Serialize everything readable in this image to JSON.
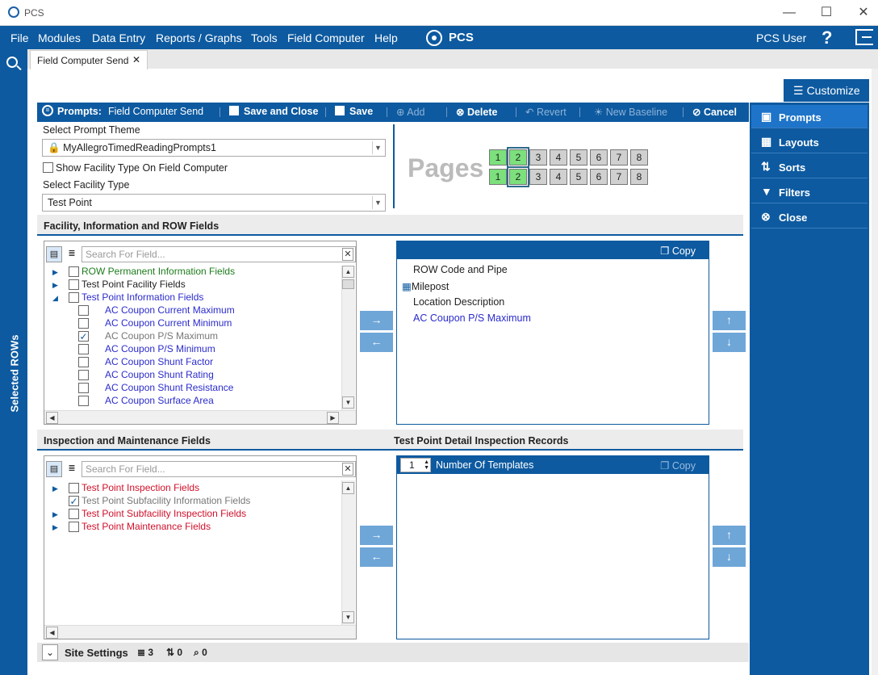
{
  "app": {
    "title": "PCS",
    "brand": "PCS",
    "user": "PCS User"
  },
  "menu": [
    "File",
    "Modules",
    "Data Entry",
    "Reports / Graphs",
    "Tools",
    "Field Computer",
    "Help"
  ],
  "tab": {
    "label": "Field Computer Send",
    "close": "✕"
  },
  "left_rail": {
    "label": "Selected ROWs"
  },
  "toolbar": {
    "prompts_label": "Prompts:",
    "prompts_value": "Field Computer Send",
    "save_close": "Save and Close",
    "save": "Save",
    "add": "Add",
    "delete": "Delete",
    "revert": "Revert",
    "new_baseline": "New Baseline",
    "cancel": "Cancel"
  },
  "customize": {
    "title": "Customize",
    "items": [
      "Prompts",
      "Layouts",
      "Sorts",
      "Filters",
      "Close"
    ]
  },
  "theme": {
    "label": "Select Prompt Theme",
    "value": "MyAllegroTimedReadingPrompts1",
    "show_facility_label": "Show Facility Type On Field Computer",
    "facility_label": "Select Facility Type",
    "facility_value": "Test Point"
  },
  "pages": {
    "label": "Pages",
    "row1": [
      "1",
      "2",
      "3",
      "4",
      "5",
      "6",
      "7",
      "8"
    ],
    "row2": [
      "1",
      "2",
      "3",
      "4",
      "5",
      "6",
      "7",
      "8"
    ]
  },
  "section1": {
    "title": "Facility, Information and ROW Fields",
    "search_placeholder": "Search For Field...",
    "tree": [
      "ROW Permanent Information Fields",
      "Test Point Facility Fields",
      "Test Point Information Fields",
      "AC Coupon Current Maximum",
      "AC Coupon Current Minimum",
      "AC Coupon P/S Maximum",
      "AC Coupon P/S Minimum",
      "AC Coupon Shunt Factor",
      "AC Coupon Shunt Rating",
      "AC Coupon Shunt Resistance",
      "AC Coupon Surface Area"
    ],
    "copy": "Copy",
    "selected_fields": [
      "ROW Code and Pipe",
      "Milepost",
      "Location Description",
      "AC Coupon P/S Maximum"
    ]
  },
  "section2": {
    "title": "Inspection and Maintenance Fields",
    "right_title": "Test Point Detail Inspection Records",
    "search_placeholder": "Search For Field...",
    "tree": [
      "Test Point Inspection Fields",
      "Test Point Subfacility Information Fields",
      "Test Point Subfacility Inspection Fields",
      "Test Point Maintenance Fields"
    ],
    "templates_count": "1",
    "templates_label": "Number Of Templates",
    "copy": "Copy"
  },
  "footer": {
    "label": "Site Settings",
    "count1": "3",
    "count2": "0",
    "count3": "0"
  },
  "colors": {
    "primary": "#0d5aa0",
    "page_green": "#7ce07c",
    "red_field": "#d0102a",
    "blue_field": "#2b2bcc"
  }
}
